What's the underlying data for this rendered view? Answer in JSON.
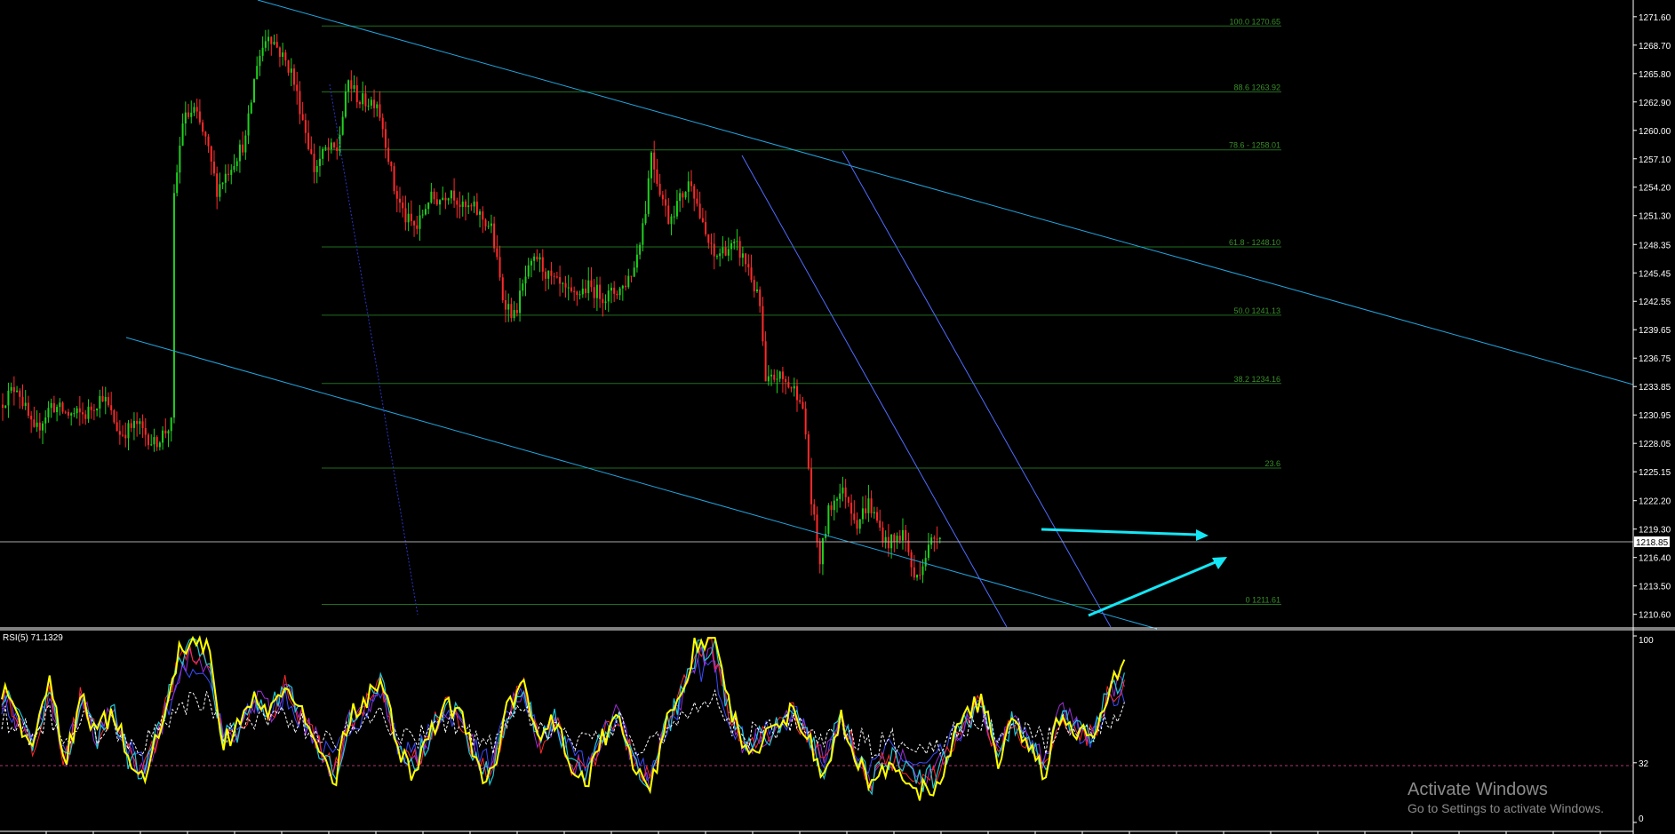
{
  "colors": {
    "background": "#000000",
    "bull_candle": "#1fd11f",
    "bear_candle": "#ff2a2a",
    "fib_line": "#1f6e1f",
    "fib_text": "#3a8f2a",
    "channel_line": "#21a6e0",
    "steep_channel": "#4f6cff",
    "dotted_line": "#2b34c8",
    "arrow": "#14e6f5",
    "current_price": "#aaaaaa",
    "rsi_main": "#ffff00",
    "rsi_teal": "#20c8d8",
    "rsi_purple": "#9b2fd4",
    "rsi_red": "#ff2a2a",
    "rsi_blue": "#3a4cff",
    "rsi_ma": "#ffffff",
    "rsi_level": "#b03a6e"
  },
  "chart_data": [
    {
      "type": "candlestick",
      "title": "",
      "xlabel": "",
      "ylabel": "",
      "ylim": [
        1209.3,
        1272.4
      ],
      "price_ticks": [
        "1271.60",
        "1268.70",
        "1265.80",
        "1262.90",
        "1260.00",
        "1257.10",
        "1254.20",
        "1251.30",
        "1248.35",
        "1245.45",
        "1242.55",
        "1239.65",
        "1236.75",
        "1233.85",
        "1230.95",
        "1228.05",
        "1225.15",
        "1222.20",
        "1219.30",
        "1216.40",
        "1213.50",
        "1210.60"
      ],
      "current_price": "1218.85",
      "fibonacci_levels": [
        {
          "label": "100.0 1270.65",
          "price": 1270.65
        },
        {
          "label": "88.6 1263.92",
          "price": 1263.92
        },
        {
          "label": "78.6 - 1258.01",
          "price": 1258.01
        },
        {
          "label": "61.8 - 1248.10",
          "price": 1248.1
        },
        {
          "label": "50.0 1241.13",
          "price": 1241.13
        },
        {
          "label": "38.2 1234.16",
          "price": 1234.16
        },
        {
          "label": "23.6",
          "price": 1225.53
        },
        {
          "label": "0 1211.61",
          "price": 1211.61
        }
      ],
      "price_path": [
        {
          "i": 0,
          "p": 1232
        },
        {
          "i": 6,
          "p": 1234
        },
        {
          "i": 12,
          "p": 1229
        },
        {
          "i": 18,
          "p": 1232
        },
        {
          "i": 24,
          "p": 1231
        },
        {
          "i": 30,
          "p": 1231
        },
        {
          "i": 36,
          "p": 1233
        },
        {
          "i": 42,
          "p": 1229
        },
        {
          "i": 48,
          "p": 1230
        },
        {
          "i": 54,
          "p": 1228
        },
        {
          "i": 60,
          "p": 1230
        },
        {
          "i": 61,
          "p": 1253
        },
        {
          "i": 64,
          "p": 1261
        },
        {
          "i": 68,
          "p": 1262
        },
        {
          "i": 72,
          "p": 1259
        },
        {
          "i": 76,
          "p": 1254
        },
        {
          "i": 80,
          "p": 1256
        },
        {
          "i": 86,
          "p": 1259
        },
        {
          "i": 90,
          "p": 1267
        },
        {
          "i": 94,
          "p": 1270
        },
        {
          "i": 98,
          "p": 1268
        },
        {
          "i": 102,
          "p": 1266
        },
        {
          "i": 107,
          "p": 1260
        },
        {
          "i": 110,
          "p": 1256
        },
        {
          "i": 114,
          "p": 1258
        },
        {
          "i": 118,
          "p": 1258
        },
        {
          "i": 122,
          "p": 1265
        },
        {
          "i": 126,
          "p": 1263
        },
        {
          "i": 132,
          "p": 1263
        },
        {
          "i": 135,
          "p": 1259
        },
        {
          "i": 138,
          "p": 1254
        },
        {
          "i": 142,
          "p": 1251
        },
        {
          "i": 146,
          "p": 1250
        },
        {
          "i": 150,
          "p": 1253
        },
        {
          "i": 154,
          "p": 1253
        },
        {
          "i": 158,
          "p": 1254
        },
        {
          "i": 162,
          "p": 1252
        },
        {
          "i": 166,
          "p": 1252
        },
        {
          "i": 172,
          "p": 1250
        },
        {
          "i": 176,
          "p": 1243
        },
        {
          "i": 180,
          "p": 1241
        },
        {
          "i": 184,
          "p": 1245
        },
        {
          "i": 188,
          "p": 1247
        },
        {
          "i": 192,
          "p": 1245
        },
        {
          "i": 196,
          "p": 1244
        },
        {
          "i": 200,
          "p": 1243
        },
        {
          "i": 206,
          "p": 1244
        },
        {
          "i": 212,
          "p": 1243
        },
        {
          "i": 218,
          "p": 1244
        },
        {
          "i": 222,
          "p": 1246
        },
        {
          "i": 226,
          "p": 1252
        },
        {
          "i": 228,
          "p": 1258
        },
        {
          "i": 230,
          "p": 1255
        },
        {
          "i": 234,
          "p": 1251
        },
        {
          "i": 238,
          "p": 1253
        },
        {
          "i": 242,
          "p": 1255
        },
        {
          "i": 246,
          "p": 1250
        },
        {
          "i": 250,
          "p": 1247
        },
        {
          "i": 254,
          "p": 1248
        },
        {
          "i": 258,
          "p": 1248
        },
        {
          "i": 262,
          "p": 1246
        },
        {
          "i": 266,
          "p": 1242
        },
        {
          "i": 268,
          "p": 1234
        },
        {
          "i": 272,
          "p": 1235
        },
        {
          "i": 276,
          "p": 1234
        },
        {
          "i": 280,
          "p": 1233
        },
        {
          "i": 282,
          "p": 1229
        },
        {
          "i": 284,
          "p": 1222
        },
        {
          "i": 287,
          "p": 1216
        },
        {
          "i": 290,
          "p": 1221
        },
        {
          "i": 293,
          "p": 1223
        },
        {
          "i": 296,
          "p": 1223
        },
        {
          "i": 300,
          "p": 1220
        },
        {
          "i": 304,
          "p": 1222
        },
        {
          "i": 307,
          "p": 1220
        },
        {
          "i": 310,
          "p": 1218
        },
        {
          "i": 313,
          "p": 1218
        },
        {
          "i": 316,
          "p": 1219
        },
        {
          "i": 318,
          "p": 1217
        },
        {
          "i": 320,
          "p": 1214
        },
        {
          "i": 323,
          "p": 1216
        },
        {
          "i": 326,
          "p": 1218
        },
        {
          "i": 328,
          "p": 1219
        }
      ],
      "x_start": 0,
      "x_end": 1058,
      "n_candles": 329
    },
    {
      "type": "line",
      "title": "RSI(5) 71.1329",
      "ylim": [
        0,
        100
      ],
      "levels": [
        "100",
        "32",
        "0"
      ],
      "level_values": [
        100,
        32,
        0
      ],
      "series": [
        {
          "key": "yellow",
          "anchors": [
            70,
            55,
            40,
            75,
            30,
            68,
            45,
            60,
            35,
            25,
            50,
            82,
            95,
            90,
            45,
            50,
            68,
            60,
            75,
            55,
            42,
            25,
            55,
            62,
            78,
            40,
            30,
            45,
            65,
            55,
            35,
            25,
            60,
            75,
            42,
            55,
            30,
            25,
            45,
            60,
            30,
            20,
            50,
            70,
            92,
            95,
            60,
            40,
            45,
            50,
            62,
            45,
            30,
            55,
            40,
            20,
            35,
            30,
            22,
            25,
            40,
            55,
            65,
            35,
            55,
            40,
            30,
            60,
            50,
            45,
            70,
            78
          ]
        }
      ]
    }
  ]
}
